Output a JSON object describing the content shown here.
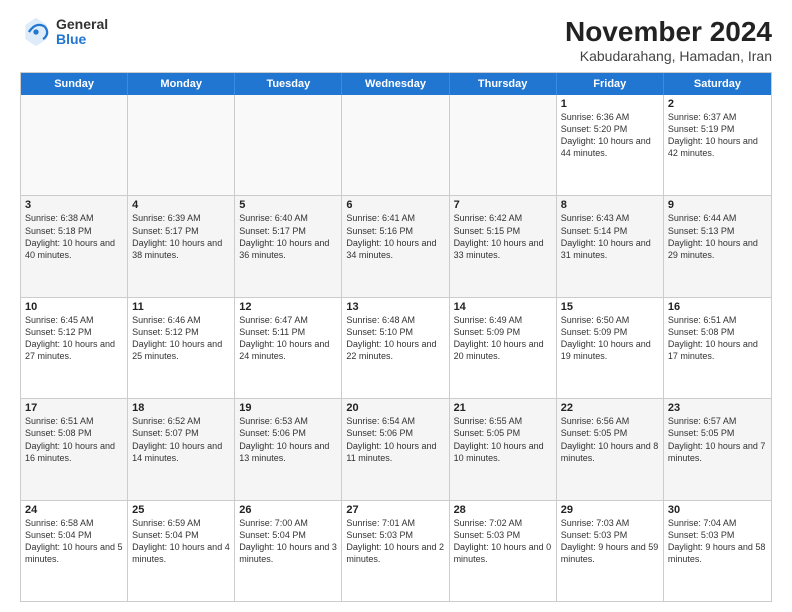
{
  "logo": {
    "general": "General",
    "blue": "Blue"
  },
  "header": {
    "title": "November 2024",
    "subtitle": "Kabudarahang, Hamadan, Iran"
  },
  "days": [
    "Sunday",
    "Monday",
    "Tuesday",
    "Wednesday",
    "Thursday",
    "Friday",
    "Saturday"
  ],
  "rows": [
    [
      {
        "day": "",
        "text": "",
        "empty": true
      },
      {
        "day": "",
        "text": "",
        "empty": true
      },
      {
        "day": "",
        "text": "",
        "empty": true
      },
      {
        "day": "",
        "text": "",
        "empty": true
      },
      {
        "day": "",
        "text": "",
        "empty": true
      },
      {
        "day": "1",
        "text": "Sunrise: 6:36 AM\nSunset: 5:20 PM\nDaylight: 10 hours and 44 minutes."
      },
      {
        "day": "2",
        "text": "Sunrise: 6:37 AM\nSunset: 5:19 PM\nDaylight: 10 hours and 42 minutes."
      }
    ],
    [
      {
        "day": "3",
        "text": "Sunrise: 6:38 AM\nSunset: 5:18 PM\nDaylight: 10 hours and 40 minutes."
      },
      {
        "day": "4",
        "text": "Sunrise: 6:39 AM\nSunset: 5:17 PM\nDaylight: 10 hours and 38 minutes."
      },
      {
        "day": "5",
        "text": "Sunrise: 6:40 AM\nSunset: 5:17 PM\nDaylight: 10 hours and 36 minutes."
      },
      {
        "day": "6",
        "text": "Sunrise: 6:41 AM\nSunset: 5:16 PM\nDaylight: 10 hours and 34 minutes."
      },
      {
        "day": "7",
        "text": "Sunrise: 6:42 AM\nSunset: 5:15 PM\nDaylight: 10 hours and 33 minutes."
      },
      {
        "day": "8",
        "text": "Sunrise: 6:43 AM\nSunset: 5:14 PM\nDaylight: 10 hours and 31 minutes."
      },
      {
        "day": "9",
        "text": "Sunrise: 6:44 AM\nSunset: 5:13 PM\nDaylight: 10 hours and 29 minutes."
      }
    ],
    [
      {
        "day": "10",
        "text": "Sunrise: 6:45 AM\nSunset: 5:12 PM\nDaylight: 10 hours and 27 minutes."
      },
      {
        "day": "11",
        "text": "Sunrise: 6:46 AM\nSunset: 5:12 PM\nDaylight: 10 hours and 25 minutes."
      },
      {
        "day": "12",
        "text": "Sunrise: 6:47 AM\nSunset: 5:11 PM\nDaylight: 10 hours and 24 minutes."
      },
      {
        "day": "13",
        "text": "Sunrise: 6:48 AM\nSunset: 5:10 PM\nDaylight: 10 hours and 22 minutes."
      },
      {
        "day": "14",
        "text": "Sunrise: 6:49 AM\nSunset: 5:09 PM\nDaylight: 10 hours and 20 minutes."
      },
      {
        "day": "15",
        "text": "Sunrise: 6:50 AM\nSunset: 5:09 PM\nDaylight: 10 hours and 19 minutes."
      },
      {
        "day": "16",
        "text": "Sunrise: 6:51 AM\nSunset: 5:08 PM\nDaylight: 10 hours and 17 minutes."
      }
    ],
    [
      {
        "day": "17",
        "text": "Sunrise: 6:51 AM\nSunset: 5:08 PM\nDaylight: 10 hours and 16 minutes."
      },
      {
        "day": "18",
        "text": "Sunrise: 6:52 AM\nSunset: 5:07 PM\nDaylight: 10 hours and 14 minutes."
      },
      {
        "day": "19",
        "text": "Sunrise: 6:53 AM\nSunset: 5:06 PM\nDaylight: 10 hours and 13 minutes."
      },
      {
        "day": "20",
        "text": "Sunrise: 6:54 AM\nSunset: 5:06 PM\nDaylight: 10 hours and 11 minutes."
      },
      {
        "day": "21",
        "text": "Sunrise: 6:55 AM\nSunset: 5:05 PM\nDaylight: 10 hours and 10 minutes."
      },
      {
        "day": "22",
        "text": "Sunrise: 6:56 AM\nSunset: 5:05 PM\nDaylight: 10 hours and 8 minutes."
      },
      {
        "day": "23",
        "text": "Sunrise: 6:57 AM\nSunset: 5:05 PM\nDaylight: 10 hours and 7 minutes."
      }
    ],
    [
      {
        "day": "24",
        "text": "Sunrise: 6:58 AM\nSunset: 5:04 PM\nDaylight: 10 hours and 5 minutes."
      },
      {
        "day": "25",
        "text": "Sunrise: 6:59 AM\nSunset: 5:04 PM\nDaylight: 10 hours and 4 minutes."
      },
      {
        "day": "26",
        "text": "Sunrise: 7:00 AM\nSunset: 5:04 PM\nDaylight: 10 hours and 3 minutes."
      },
      {
        "day": "27",
        "text": "Sunrise: 7:01 AM\nSunset: 5:03 PM\nDaylight: 10 hours and 2 minutes."
      },
      {
        "day": "28",
        "text": "Sunrise: 7:02 AM\nSunset: 5:03 PM\nDaylight: 10 hours and 0 minutes."
      },
      {
        "day": "29",
        "text": "Sunrise: 7:03 AM\nSunset: 5:03 PM\nDaylight: 9 hours and 59 minutes."
      },
      {
        "day": "30",
        "text": "Sunrise: 7:04 AM\nSunset: 5:03 PM\nDaylight: 9 hours and 58 minutes."
      }
    ]
  ]
}
